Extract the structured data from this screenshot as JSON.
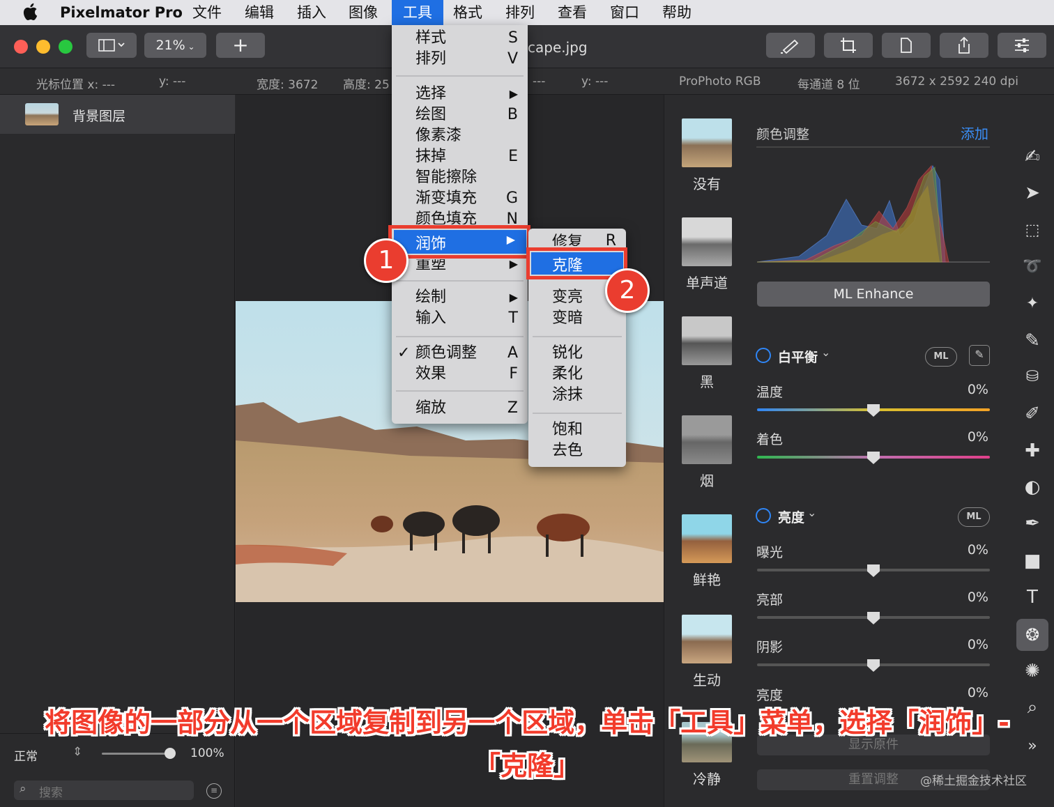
{
  "menubar": {
    "app": "Pixelmator Pro",
    "items": [
      "文件",
      "编辑",
      "插入",
      "图像",
      "工具",
      "格式",
      "排列",
      "查看",
      "窗口",
      "帮助"
    ]
  },
  "toolbar": {
    "zoom": "21%",
    "add": "+",
    "filename": "cape.jpg"
  },
  "infobar": {
    "cursor_x": "光标位置 x: ---",
    "cursor_y": "y: ---",
    "width": "宽度: 3672",
    "height": "高度: 25",
    "x2": "---",
    "y2": "y: ---",
    "profile": "ProPhoto RGB",
    "depth": "每通道 8 位",
    "size": "3672 x 2592 240 dpi"
  },
  "layers": {
    "name": "背景图层",
    "blend": "正常",
    "opacity": "100%",
    "search_placeholder": "搜索"
  },
  "tools_menu": {
    "items": [
      {
        "label": "样式",
        "sc": "S"
      },
      {
        "label": "排列",
        "sc": "V"
      },
      {
        "label": "选择",
        "sc": "▶"
      },
      {
        "label": "绘图",
        "sc": "B"
      },
      {
        "label": "像素漆",
        "sc": ""
      },
      {
        "label": "抹掉",
        "sc": "E"
      },
      {
        "label": "智能擦除",
        "sc": ""
      },
      {
        "label": "渐变填充",
        "sc": "G"
      },
      {
        "label": "颜色填充",
        "sc": "N"
      },
      {
        "label": "润饰",
        "sc": "▶"
      },
      {
        "label": "重塑",
        "sc": "▶"
      },
      {
        "label": "绘制",
        "sc": "▶"
      },
      {
        "label": "输入",
        "sc": "T"
      },
      {
        "label": "颜色调整",
        "sc": "A"
      },
      {
        "label": "效果",
        "sc": "F"
      },
      {
        "label": "缩放",
        "sc": "Z"
      }
    ],
    "checkmark": "✓"
  },
  "retouch_menu": {
    "items": [
      {
        "label": "修复",
        "sc": "R"
      },
      {
        "label": "克隆",
        "sc": ""
      },
      {
        "label": "变亮",
        "sc": ""
      },
      {
        "label": "变暗",
        "sc": ""
      },
      {
        "label": "锐化",
        "sc": ""
      },
      {
        "label": "柔化",
        "sc": ""
      },
      {
        "label": "涂抹",
        "sc": ""
      },
      {
        "label": "饱和",
        "sc": ""
      },
      {
        "label": "去色",
        "sc": ""
      }
    ]
  },
  "badges": [
    "1",
    "2"
  ],
  "presets": [
    "没有",
    "单声道",
    "黑",
    "烟",
    "鲜艳",
    "生动",
    "冷静"
  ],
  "adjust": {
    "title": "颜色调整",
    "add": "添加",
    "ml_enhance": "ML Enhance",
    "wb": "白平衡",
    "ml": "ML",
    "temp": "温度",
    "temp_val": "0%",
    "tint": "着色",
    "tint_val": "0%",
    "light": "亮度",
    "exposure": "曝光",
    "exposure_val": "0%",
    "highlights": "亮部",
    "highlights_val": "0%",
    "shadows": "阴影",
    "shadows_val": "0%",
    "brightness": "亮度",
    "brightness_val": "0%",
    "show_original": "显示原件",
    "reset": "重置调整"
  },
  "caption": {
    "line1": "将图像的一部分从一个区域复制到另一个区域，单击「工具」菜单，选择「润饰」-",
    "line2": "「克隆」"
  },
  "watermark": "@稀土掘金技术社区"
}
